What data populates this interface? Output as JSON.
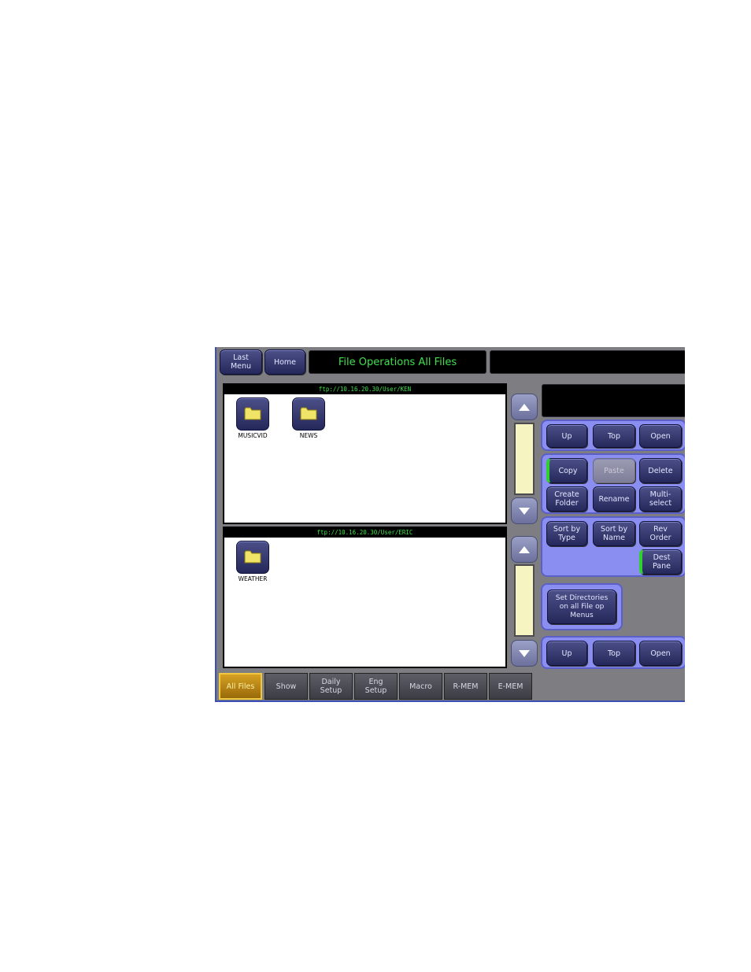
{
  "header": {
    "last_menu": "Last\nMenu",
    "home": "Home",
    "title": "File Operations All Files",
    "status": ""
  },
  "top_pane": {
    "path": "ftp://10.16.20.30/User/KEN",
    "folders": [
      "MUSICVID",
      "NEWS"
    ]
  },
  "bottom_pane": {
    "path": "ftp://10.16.20.30/User/ERIC",
    "folders": [
      "WEATHER"
    ]
  },
  "right_display": "",
  "nav_top": {
    "up": "Up",
    "top": "Top",
    "open": "Open"
  },
  "edit": {
    "copy": "Copy",
    "paste": "Paste",
    "delete": "Delete",
    "create_folder": "Create\nFolder",
    "rename": "Rename",
    "multi_select": "Multi-\nselect"
  },
  "sort": {
    "by_type": "Sort by\nType",
    "by_name": "Sort by\nName",
    "rev_order": "Rev\nOrder",
    "dest_pane": "Dest\nPane"
  },
  "set_directories": "Set Directories\non all File op\nMenus",
  "nav_bottom": {
    "up": "Up",
    "top": "Top",
    "open": "Open"
  },
  "tabs": {
    "all_files": "All Files",
    "show": "Show",
    "daily_setup": "Daily\nSetup",
    "eng_setup": "Eng\nSetup",
    "macro": "Macro",
    "r_mem": "R-MEM",
    "e_mem": "E-MEM"
  },
  "colors": {
    "display_text": "#3fe04a",
    "button": "#383c70",
    "group_bg": "#8a8ef0",
    "selected_tab": "#d6a123",
    "scroll_track": "#f6f4c0"
  }
}
